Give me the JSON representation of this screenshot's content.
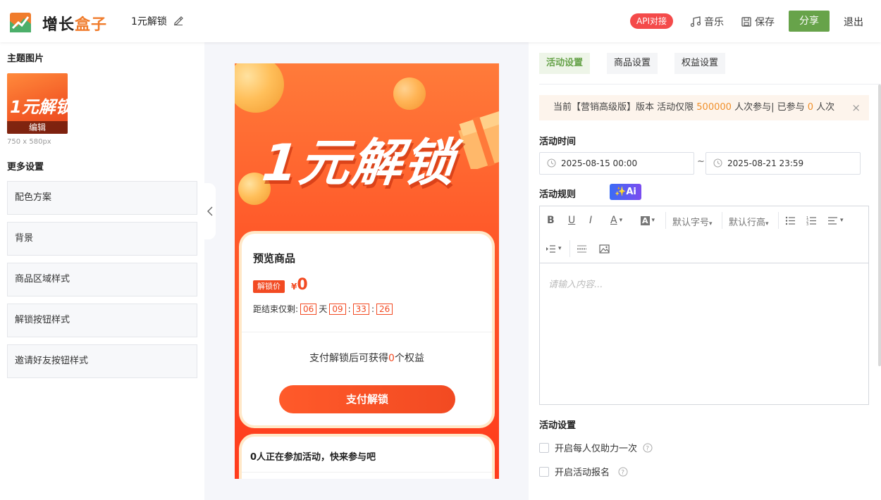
{
  "header": {
    "logo_text_main": "增长",
    "logo_text_accent": "盒子",
    "page_title": "1元解锁",
    "api_badge": "API对接",
    "music_label": "音乐",
    "save_label": "保存",
    "share_label": "分享",
    "exit_label": "退出"
  },
  "left": {
    "theme_label": "主题图片",
    "thumb_text": "1元解锁",
    "thumb_edit": "编辑",
    "thumb_size": "750 x 580px",
    "more_settings_label": "更多设置",
    "settings": [
      "配色方案",
      "背景",
      "商品区域样式",
      "解锁按钮样式",
      "邀请好友按钮样式"
    ]
  },
  "preview": {
    "banner_text": "1元解锁",
    "card_title": "预览商品",
    "unlock_tag": "解锁价",
    "yen": "¥",
    "price": "0",
    "countdown_label": "距结束仅剩:",
    "days": "06",
    "day_unit": "天",
    "hours": "09",
    "minutes": "33",
    "seconds": "26",
    "colon": ":",
    "benefit_prefix": "支付解锁后可获得",
    "benefit_count": "0",
    "benefit_suffix": "个权益",
    "pay_button": "支付解锁",
    "participants": "0人正在参加活动，快来参与吧"
  },
  "right": {
    "tabs": [
      "活动设置",
      "商品设置",
      "权益设置"
    ],
    "notice_prefix": "当前【营销高级版】版本 活动仅限",
    "notice_limit": "500000",
    "notice_mid": "人次参与| 已参与",
    "notice_count": "0",
    "notice_suffix": "人次",
    "notice_close": "×",
    "time_label": "活动时间",
    "start_time": "2025-08-15 00:00",
    "tilde": "~",
    "end_time": "2025-08-21 23:59",
    "rules_label": "活动规则",
    "ai_label": "✨Ai",
    "font_size_select": "默认字号",
    "line_height_select": "默认行高",
    "editor_placeholder": "请输入内容...",
    "activity_settings_label": "活动设置",
    "check_once": "开启每人仅助力一次",
    "check_signup": "开启活动报名"
  },
  "colors": {
    "brand_green": "#67a34a",
    "accent_orange": "#f07c2c",
    "api_red": "#f44a4a",
    "preview_red": "#f24a22"
  }
}
